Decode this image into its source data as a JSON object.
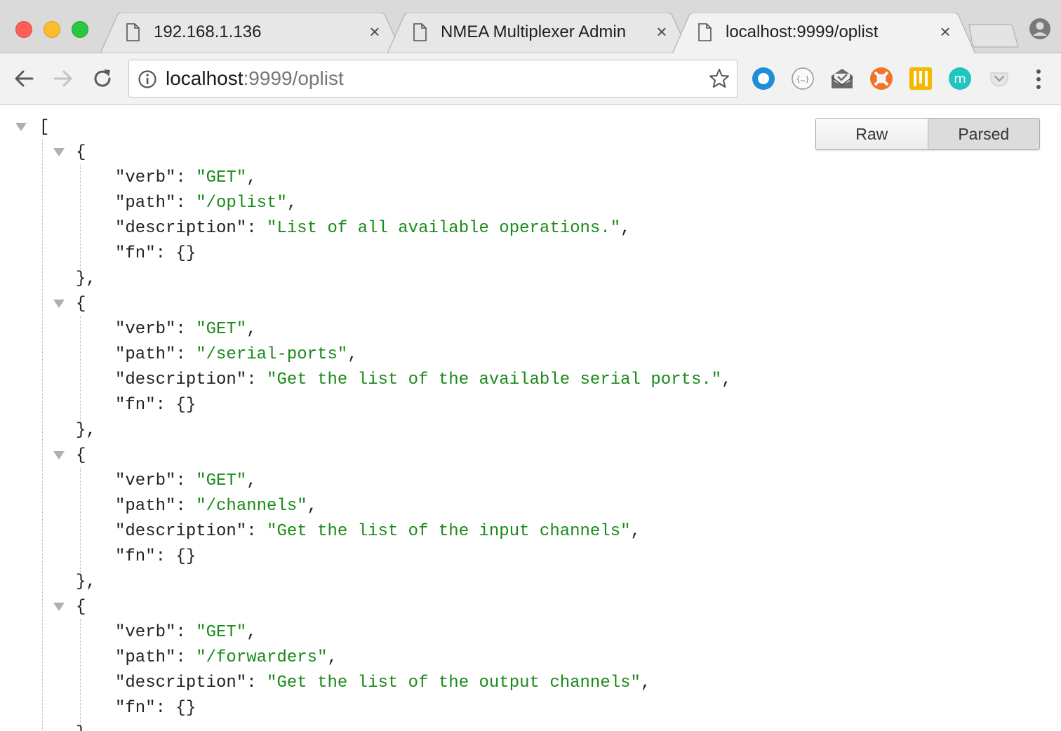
{
  "tabs": [
    {
      "title": "192.168.1.136",
      "active": false
    },
    {
      "title": "NMEA Multiplexer Admin",
      "active": false
    },
    {
      "title": "localhost:9999/oplist",
      "active": true
    }
  ],
  "tab_close_glyph": "×",
  "address": {
    "host": "localhost",
    "rest": ":9999/oplist"
  },
  "icons": {
    "window_controls": [
      "close-window-icon",
      "minimize-window-icon",
      "zoom-window-icon"
    ],
    "toolbar": [
      "back-arrow-icon",
      "forward-arrow-icon",
      "reload-icon",
      "info-icon",
      "bookmark-star-icon"
    ],
    "extensions": [
      "circle-extension-icon",
      "json-formatter-extension-icon",
      "mail-extension-icon",
      "lifebuoy-extension-icon",
      "columns-extension-icon",
      "m-extension-icon",
      "pocket-extension-icon"
    ],
    "menu": "more-menu-icon",
    "profile": "profile-icon"
  },
  "viewer": {
    "raw_label": "Raw",
    "parsed_label": "Parsed",
    "active_view": "Parsed"
  },
  "json": {
    "open_bracket": "[",
    "items": [
      {
        "verb": "GET",
        "path": "/oplist",
        "description": "List of all available operations.",
        "fn": "{}"
      },
      {
        "verb": "GET",
        "path": "/serial-ports",
        "description": "Get the list of the available serial ports.",
        "fn": "{}"
      },
      {
        "verb": "GET",
        "path": "/channels",
        "description": "Get the list of the input channels",
        "fn": "{}"
      },
      {
        "verb": "GET",
        "path": "/forwarders",
        "description": "Get the list of the output channels",
        "fn": "{}"
      }
    ]
  }
}
